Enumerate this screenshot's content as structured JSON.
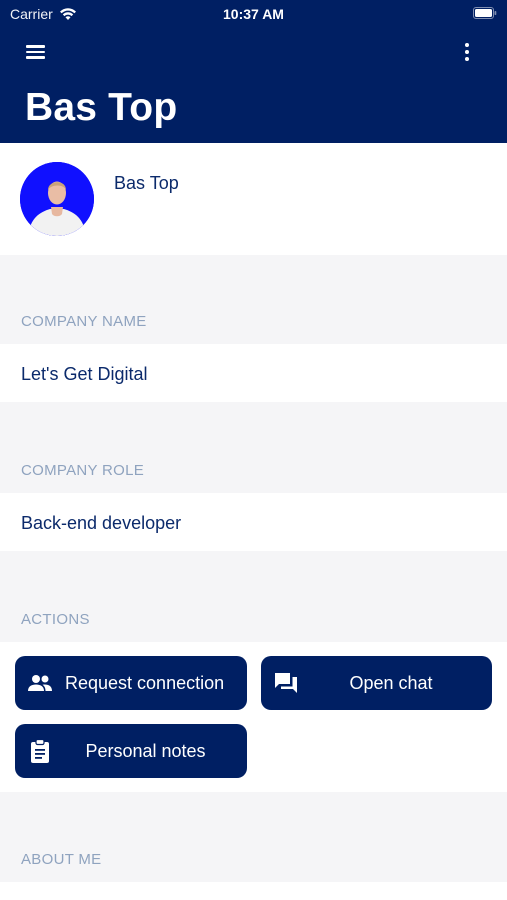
{
  "status_bar": {
    "carrier": "Carrier",
    "time": "10:37 AM"
  },
  "header": {
    "title": "Bas Top"
  },
  "profile": {
    "name": "Bas Top"
  },
  "sections": {
    "company_name": {
      "label": "COMPANY NAME",
      "value": "Let's Get Digital"
    },
    "company_role": {
      "label": "COMPANY ROLE",
      "value": "Back-end developer"
    },
    "actions": {
      "label": "ACTIONS"
    },
    "about_me": {
      "label": "ABOUT ME"
    }
  },
  "actions": {
    "request_connection": {
      "label": "Request connection",
      "icon": "people-icon"
    },
    "open_chat": {
      "label": "Open chat",
      "icon": "chat-icon"
    },
    "personal_notes": {
      "label": "Personal notes",
      "icon": "clipboard-icon"
    }
  },
  "colors": {
    "primary": "#001f63",
    "text_dark": "#0b2a6b",
    "label_muted": "#8fa3bf",
    "background": "#f5f5f7",
    "avatar_bg": "#1010ff"
  }
}
